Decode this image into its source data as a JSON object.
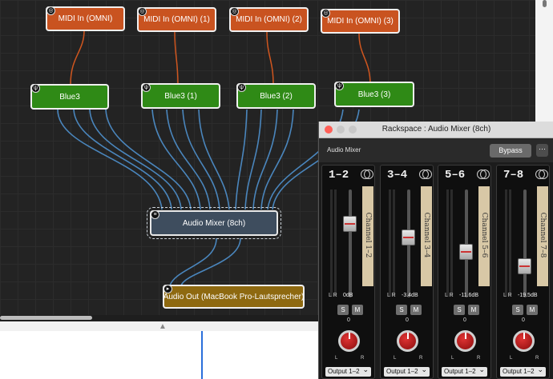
{
  "canvas": {
    "midi_nodes": [
      "MIDI In (OMNI)",
      "MIDI In (OMNI) (1)",
      "MIDI In (OMNI) (2)",
      "MIDI In (OMNI) (3)"
    ],
    "blue3_nodes": [
      "Blue3",
      "Blue3 (1)",
      "Blue3 (2)",
      "Blue3 (3)"
    ],
    "mixer_node": "Audio Mixer (8ch)",
    "audio_out_node": "Audio Out (MacBook Pro-Lautsprecher)"
  },
  "plugin_window": {
    "title": "Rackspace : Audio Mixer (8ch)",
    "host_label": "Audio Mixer",
    "bypass_label": "Bypass",
    "more_label": "···",
    "strips": [
      {
        "title": "1–2",
        "tape": "Channel 1–2",
        "db": "0dB",
        "solo": "S",
        "mute": "M",
        "pan": "0",
        "output": "Output 1–2",
        "fader_level": 0.72
      },
      {
        "title": "3–4",
        "tape": "Channel 3–4",
        "db": "-3.4dB",
        "solo": "S",
        "mute": "M",
        "pan": "0",
        "output": "Output 1–2",
        "fader_level": 0.58
      },
      {
        "title": "5–6",
        "tape": "Channel 5–6",
        "db": "-11.6dB",
        "solo": "S",
        "mute": "M",
        "pan": "0",
        "output": "Output 1–2",
        "fader_level": 0.42
      },
      {
        "title": "7–8",
        "tape": "Channel 7–8",
        "db": "-19.5dB",
        "solo": "S",
        "mute": "M",
        "pan": "0",
        "output": "Output 1–2",
        "fader_level": 0.27
      }
    ],
    "lr_label": "L R",
    "pan_l": "L",
    "pan_r": "R"
  },
  "colors": {
    "midi": "#c95320",
    "blue3": "#2f8a16",
    "mixer": "#3e4d5e",
    "audio_out": "#8e6910",
    "wire_midi": "#d0561f",
    "wire_audio": "#4a86bd"
  }
}
